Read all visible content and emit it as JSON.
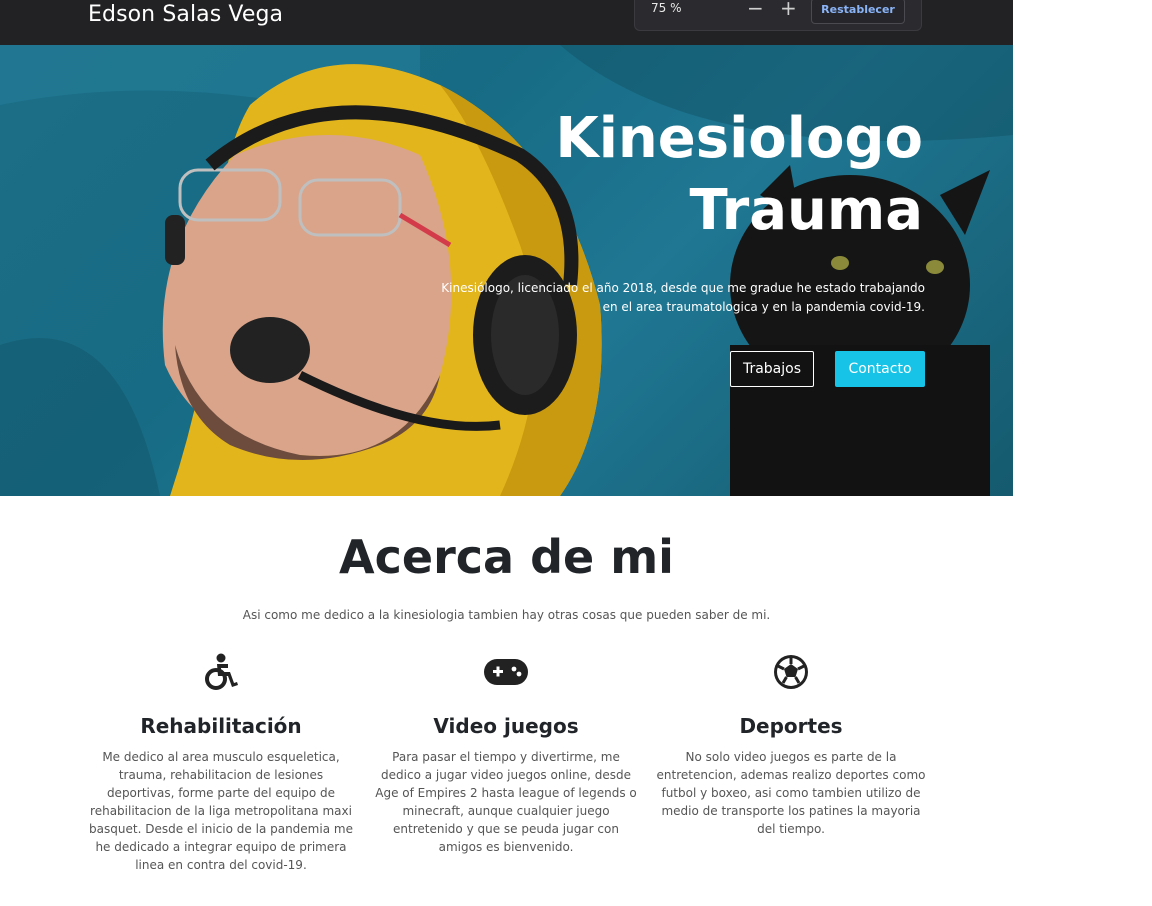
{
  "navbar": {
    "brand": "Edson Salas Vega"
  },
  "zoom_popup": {
    "level": "75 %",
    "decrease": "−",
    "increase": "+",
    "reset_label": "Restablecer"
  },
  "hero": {
    "title_line1": "Kinesiologo",
    "title_line2": "Trauma",
    "description": "Kinesiólogo, licenciado el año 2018, desde que me gradue he estado trabajando en el area traumatologica y en la pandemia covid-19.",
    "button_trabajos": "Trabajos",
    "button_contacto": "Contacto"
  },
  "about": {
    "title": "Acerca de mi",
    "subtitle": "Asi como me dedico a la kinesiologia tambien hay otras cosas que pueden saber de mi.",
    "features": [
      {
        "icon": "wheelchair-icon",
        "title": "Rehabilitación",
        "text": "Me dedico al area musculo esqueletica, trauma, rehabilitacion de lesiones deportivas, forme parte del equipo de rehabilitacion de la liga metropolitana maxi basquet. Desde el inicio de la pandemia me he dedicado a integrar equipo de primera linea en contra del covid-19."
      },
      {
        "icon": "gamepad-icon",
        "title": "Video juegos",
        "text": "Para pasar el tiempo y divertirme, me dedico a jugar video juegos online, desde Age of Empires 2 hasta league of legends o minecraft, aunque cualquier juego entretenido y que se peuda jugar con amigos es bienvenido."
      },
      {
        "icon": "soccer-ball-icon",
        "title": "Deportes",
        "text": "No solo video juegos es parte de la entretencion, ademas realizo deportes como futbol y boxeo, asi como tambien utilizo de medio de transporte los patines la mayoria del tiempo."
      }
    ]
  },
  "colors": {
    "navbar_bg": "#222225",
    "accent": "#17c4e8",
    "hero_bg": "#1d6e86"
  }
}
